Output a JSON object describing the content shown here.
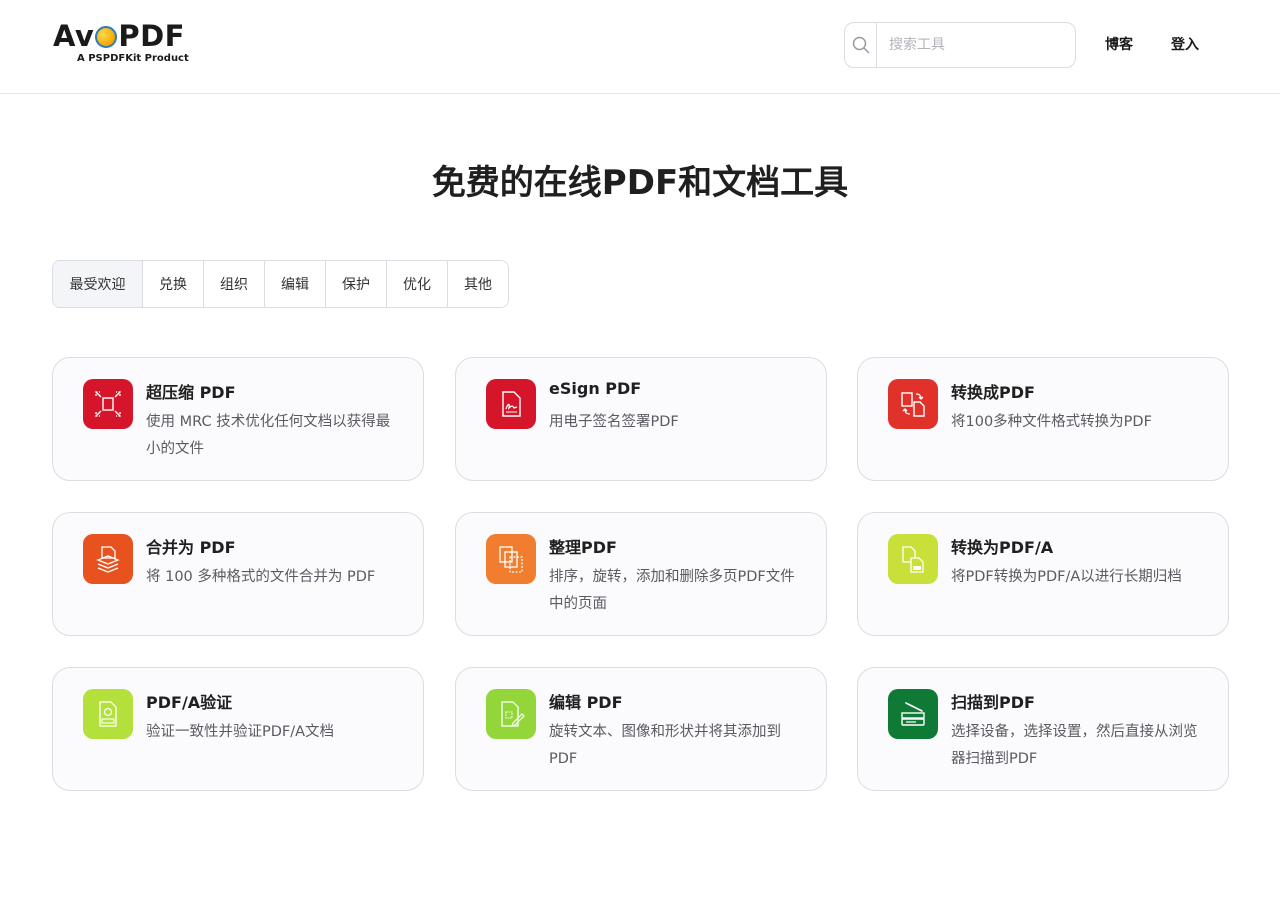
{
  "header": {
    "logo_main_left": "Av",
    "logo_main_right": "PDF",
    "logo_sub": "A PSPDFKit Product",
    "search_placeholder": "搜索工具",
    "search_value": "",
    "nav": {
      "blog": "博客",
      "login": "登入"
    }
  },
  "title": "免费的在线PDF和文档工具",
  "tabs": [
    {
      "label": "最受欢迎",
      "active": true
    },
    {
      "label": "兑换"
    },
    {
      "label": "组织"
    },
    {
      "label": "编辑"
    },
    {
      "label": "保护"
    },
    {
      "label": "优化"
    },
    {
      "label": "其他"
    }
  ],
  "cards": [
    {
      "title": "超压缩 PDF",
      "desc": "使用 MRC 技术优化任何文档以获得最小的文件",
      "icon": "compress-icon",
      "color": "#d4152a"
    },
    {
      "title": "eSign PDF",
      "desc": "用电子签名签署PDF",
      "icon": "signature-icon",
      "color": "#d4152a"
    },
    {
      "title": "转换成PDF",
      "desc": "将100多种文件格式转换为PDF",
      "icon": "convert-icon",
      "color": "#e0312a"
    },
    {
      "title": "合并为 PDF",
      "desc": "将 100 多种格式的文件合并为 PDF",
      "icon": "merge-icon",
      "color": "#e8521f"
    },
    {
      "title": "整理PDF",
      "desc": "排序，旋转，添加和删除多页PDF文件中的页面",
      "icon": "organize-icon",
      "color": "#f07e2e"
    },
    {
      "title": "转换为PDF/A",
      "desc": "将PDF转换为PDF/A以进行长期归档",
      "icon": "pdfa-convert-icon",
      "color": "#c9df3a"
    },
    {
      "title": "PDF/A验证",
      "desc": "验证一致性并验证PDF/A文档",
      "icon": "pdfa-validate-icon",
      "color": "#b4e03c"
    },
    {
      "title": "编辑 PDF",
      "desc": "旋转文本、图像和形状并将其添加到 PDF",
      "icon": "edit-icon",
      "color": "#92d63a"
    },
    {
      "title": "扫描到PDF",
      "desc": "选择设备，选择设置，然后直接从浏览器扫描到PDF",
      "icon": "scanner-icon",
      "color": "#0f7a35"
    }
  ]
}
